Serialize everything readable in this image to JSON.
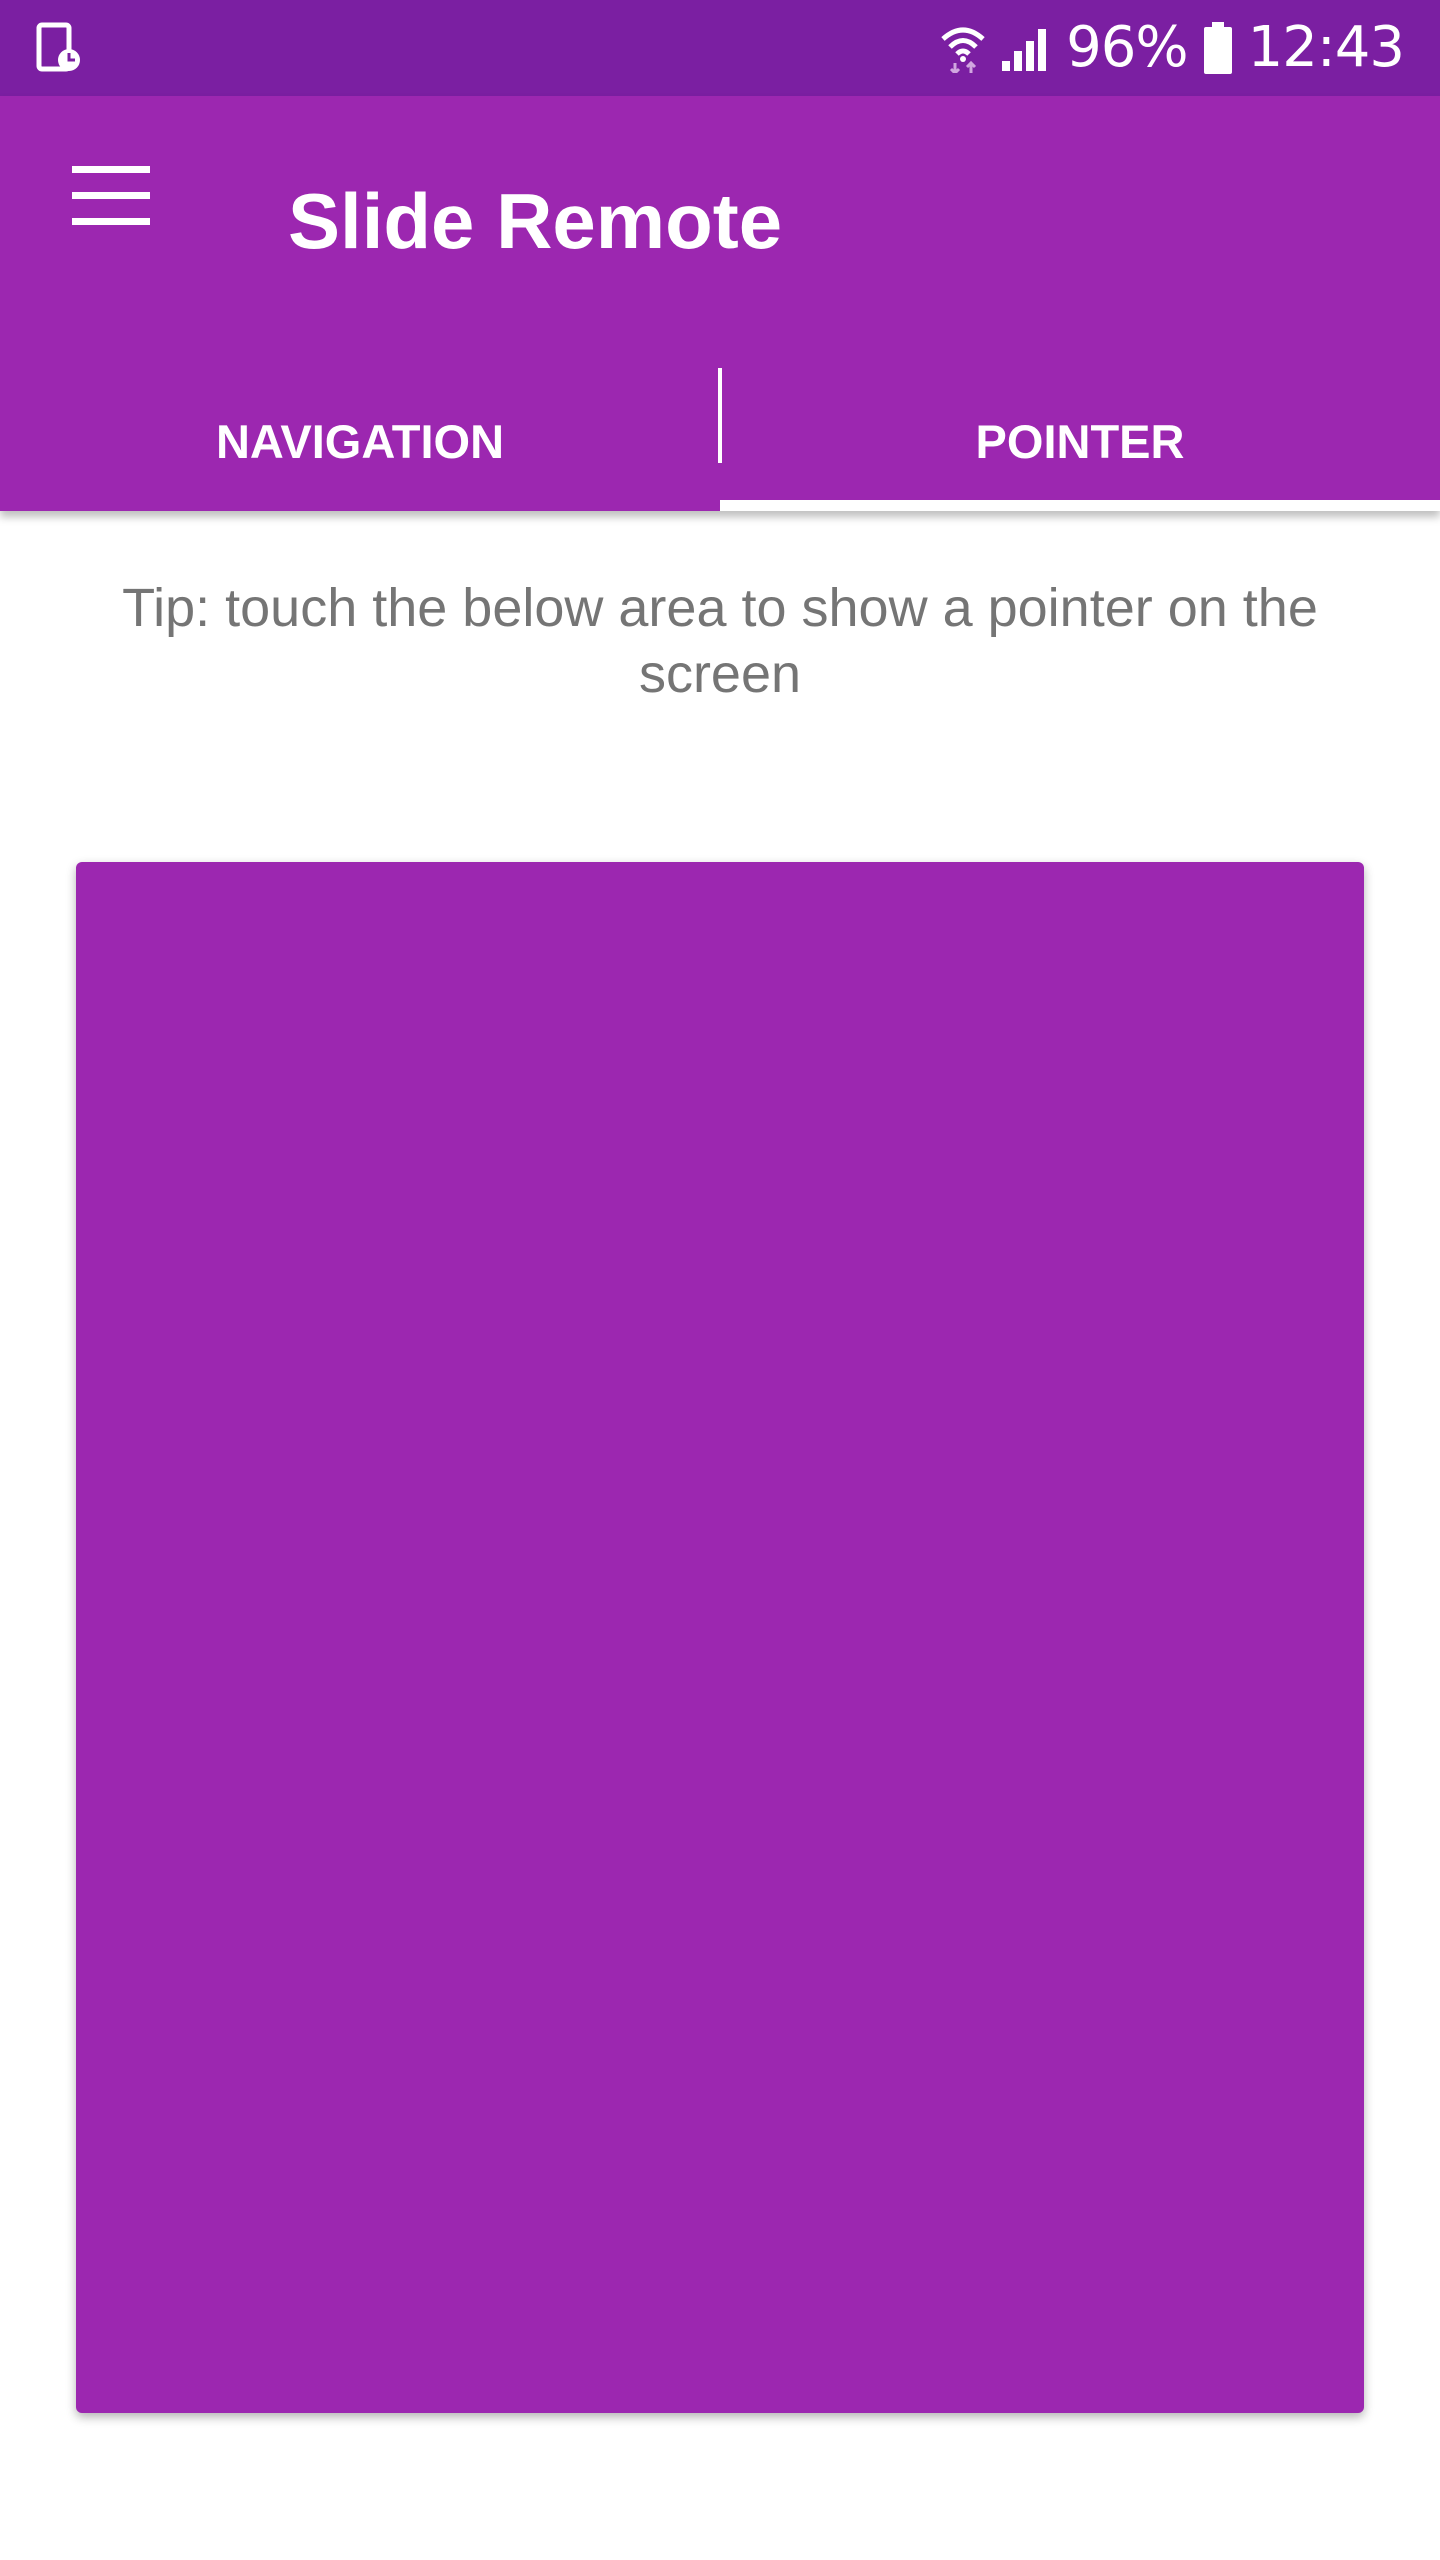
{
  "status_bar": {
    "battery_percent": "96%",
    "time": "12:43",
    "icons": [
      "screen-timer-icon",
      "wifi-icon",
      "signal-icon",
      "battery-icon"
    ]
  },
  "app_bar": {
    "title": "Slide Remote",
    "menu_icon": "hamburger-menu-icon"
  },
  "tabs": [
    {
      "label": "NAVIGATION",
      "selected": false
    },
    {
      "label": "POINTER",
      "selected": true
    }
  ],
  "tip": "Tip: touch the below area to show a pointer on the screen",
  "colors": {
    "status_bar": "#7b1fa2",
    "primary": "#9c27b0",
    "tip_text": "#757575",
    "on_primary": "#ffffff"
  }
}
